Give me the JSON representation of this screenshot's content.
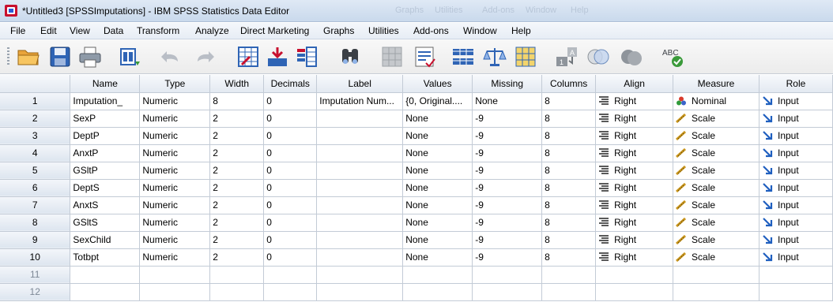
{
  "window": {
    "title": "*Untitled3 [SPSSImputations] - IBM SPSS Statistics Data Editor",
    "ghost_menus": [
      "Graphs",
      "Utilities",
      "Add-ons",
      "Window",
      "Help"
    ]
  },
  "menubar": {
    "items": [
      "File",
      "Edit",
      "View",
      "Data",
      "Transform",
      "Analyze",
      "Direct Marketing",
      "Graphs",
      "Utilities",
      "Add-ons",
      "Window",
      "Help"
    ]
  },
  "toolbar": {
    "buttons": [
      "open-icon",
      "save-icon",
      "print-icon",
      "dialog-recall-icon",
      "undo-icon",
      "redo-icon",
      "goto-case-icon",
      "goto-variable-icon",
      "variables-icon",
      "find-icon",
      "disabled-grid-icon",
      "insert-cases-icon",
      "split-file-icon",
      "weight-cases-icon",
      "select-cases-icon",
      "value-labels-icon",
      "use-sets-icon",
      "show-sets-icon",
      "spell-check-icon"
    ]
  },
  "grid": {
    "columns": [
      "Name",
      "Type",
      "Width",
      "Decimals",
      "Label",
      "Values",
      "Missing",
      "Columns",
      "Align",
      "Measure",
      "Role"
    ],
    "rows": [
      {
        "num": "1",
        "name": "Imputation_",
        "type": "Numeric",
        "width": "8",
        "decimals": "0",
        "label": "Imputation Num...",
        "values": "{0, Original....",
        "missing": "None",
        "columns": "8",
        "align": "Right",
        "measure": "Nominal",
        "role": "Input"
      },
      {
        "num": "2",
        "name": "SexP",
        "type": "Numeric",
        "width": "2",
        "decimals": "0",
        "label": "",
        "values": "None",
        "missing": "-9",
        "columns": "8",
        "align": "Right",
        "measure": "Scale",
        "role": "Input"
      },
      {
        "num": "3",
        "name": "DeptP",
        "type": "Numeric",
        "width": "2",
        "decimals": "0",
        "label": "",
        "values": "None",
        "missing": "-9",
        "columns": "8",
        "align": "Right",
        "measure": "Scale",
        "role": "Input"
      },
      {
        "num": "4",
        "name": "AnxtP",
        "type": "Numeric",
        "width": "2",
        "decimals": "0",
        "label": "",
        "values": "None",
        "missing": "-9",
        "columns": "8",
        "align": "Right",
        "measure": "Scale",
        "role": "Input"
      },
      {
        "num": "5",
        "name": "GSltP",
        "type": "Numeric",
        "width": "2",
        "decimals": "0",
        "label": "",
        "values": "None",
        "missing": "-9",
        "columns": "8",
        "align": "Right",
        "measure": "Scale",
        "role": "Input"
      },
      {
        "num": "6",
        "name": "DeptS",
        "type": "Numeric",
        "width": "2",
        "decimals": "0",
        "label": "",
        "values": "None",
        "missing": "-9",
        "columns": "8",
        "align": "Right",
        "measure": "Scale",
        "role": "Input"
      },
      {
        "num": "7",
        "name": "AnxtS",
        "type": "Numeric",
        "width": "2",
        "decimals": "0",
        "label": "",
        "values": "None",
        "missing": "-9",
        "columns": "8",
        "align": "Right",
        "measure": "Scale",
        "role": "Input"
      },
      {
        "num": "8",
        "name": "GSltS",
        "type": "Numeric",
        "width": "2",
        "decimals": "0",
        "label": "",
        "values": "None",
        "missing": "-9",
        "columns": "8",
        "align": "Right",
        "measure": "Scale",
        "role": "Input"
      },
      {
        "num": "9",
        "name": "SexChild",
        "type": "Numeric",
        "width": "2",
        "decimals": "0",
        "label": "",
        "values": "None",
        "missing": "-9",
        "columns": "8",
        "align": "Right",
        "measure": "Scale",
        "role": "Input"
      },
      {
        "num": "10",
        "name": "Totbpt",
        "type": "Numeric",
        "width": "2",
        "decimals": "0",
        "label": "",
        "values": "None",
        "missing": "-9",
        "columns": "8",
        "align": "Right",
        "measure": "Scale",
        "role": "Input"
      }
    ],
    "blank_rows": [
      "11",
      "12"
    ]
  },
  "colors": {
    "accent": "#1f5fbf",
    "measure_nominal": [
      "#d93a2b",
      "#2f9a3a",
      "#3a63c9"
    ],
    "measure_scale": "#c9961e",
    "role_input": "#1f5fbf"
  }
}
